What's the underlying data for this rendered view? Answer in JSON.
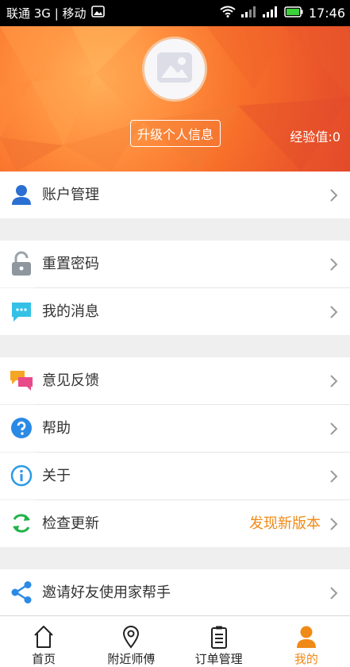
{
  "statusbar": {
    "carrier": "联通 3G | 移动",
    "time": "17:46"
  },
  "profile": {
    "upgrade_label": "升级个人信息",
    "experience": "经验值:0"
  },
  "menu": {
    "account": "账户管理",
    "reset_password": "重置密码",
    "messages": "我的消息",
    "feedback": "意见反馈",
    "help": "帮助",
    "about": "关于",
    "check_update": "检查更新",
    "update_badge": "发现新版本",
    "invite": "邀请好友使用家帮手"
  },
  "tabs": [
    {
      "label": "首页",
      "icon": "home-icon"
    },
    {
      "label": "附近师傅",
      "icon": "location-pin-icon"
    },
    {
      "label": "订单管理",
      "icon": "clipboard-icon"
    },
    {
      "label": "我的",
      "icon": "person-icon",
      "active": true
    }
  ],
  "colors": {
    "accent": "#f08a16",
    "header": "#f76f2a",
    "icon_blue": "#2a8ae6",
    "icon_green": "#21b24a"
  }
}
